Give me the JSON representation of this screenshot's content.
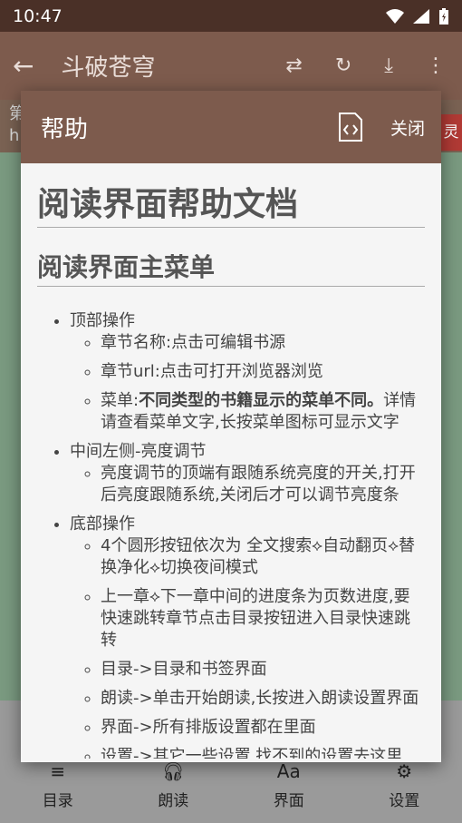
{
  "status": {
    "time": "10:47"
  },
  "app": {
    "back_icon": "arrow-left-icon",
    "title": "斗破苍穹"
  },
  "behind": {
    "left_line1": "第",
    "left_line2": "h",
    "right_badge": "灵"
  },
  "dialog": {
    "title": "帮助",
    "close_label": "关闭",
    "h1": "阅读界面帮助文档",
    "h2": "阅读界面主菜单",
    "sections": [
      {
        "title": "顶部操作",
        "items": [
          "章节名称:点击可编辑书源",
          "章节url:点击可打开浏览器浏览"
        ],
        "menu_prefix": "菜单:",
        "menu_bold": "不同类型的书籍显示的菜单不同。",
        "menu_rest": "详情请查看菜单文字,长按菜单图标可显示文字"
      },
      {
        "title": "中间左侧-亮度调节",
        "items": [
          "亮度调节的顶端有跟随系统亮度的开关,打开后亮度跟随系统,关闭后才可以调节亮度条"
        ]
      },
      {
        "title": "底部操作",
        "items": [
          "4个圆形按钮依次为 全文搜索⟡自动翻页⟡替换净化⟡切换夜间模式",
          "上一章⟡下一章中间的进度条为页数进度,要快速跳转章节点击目录按钮进入目录快速跳转",
          "目录->目录和书签界面",
          "朗读->单击开始朗读,长按进入朗读设置界面",
          "界面->所有排版设置都在里面",
          "设置->其它一些设置,找不到的设置去这里"
        ]
      }
    ]
  },
  "nav": [
    {
      "label": "目录",
      "icon": "list-icon"
    },
    {
      "label": "朗读",
      "icon": "headphones-icon"
    },
    {
      "label": "界面",
      "icon": "font-size-icon"
    },
    {
      "label": "设置",
      "icon": "gear-icon"
    }
  ]
}
